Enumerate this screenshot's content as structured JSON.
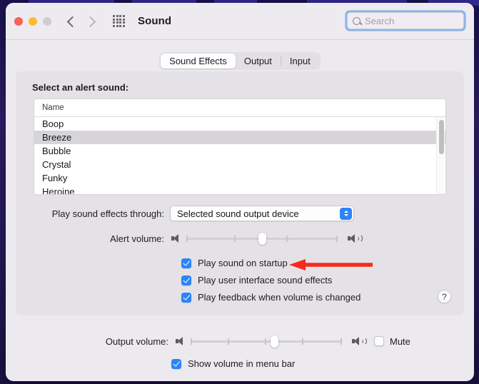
{
  "window": {
    "title": "Sound",
    "traffic_lights": [
      "close",
      "minimize",
      "zoom"
    ],
    "nav": {
      "back": "back-chevron",
      "forward": "forward-chevron"
    },
    "grid_icon": "show-all-icon"
  },
  "search": {
    "placeholder": "Search",
    "value": "",
    "icon": "search-icon"
  },
  "tabs": [
    {
      "label": "Sound Effects",
      "active": true
    },
    {
      "label": "Output",
      "active": false
    },
    {
      "label": "Input",
      "active": false
    }
  ],
  "alert_sound": {
    "section_label": "Select an alert sound:",
    "column_header": "Name",
    "items": [
      {
        "name": "Boop",
        "selected": false
      },
      {
        "name": "Breeze",
        "selected": true
      },
      {
        "name": "Bubble",
        "selected": false
      },
      {
        "name": "Crystal",
        "selected": false
      },
      {
        "name": "Funky",
        "selected": false
      },
      {
        "name": "Heroine",
        "selected": false
      }
    ]
  },
  "play_through": {
    "label": "Play sound effects through:",
    "value": "Selected sound output device"
  },
  "alert_volume": {
    "label": "Alert volume:",
    "value_percent": 50,
    "tick_count": 4,
    "low_icon": "speaker-low-icon",
    "high_icon": "speaker-high-icon"
  },
  "checkboxes": [
    {
      "label": "Play sound on startup",
      "checked": true
    },
    {
      "label": "Play user interface sound effects",
      "checked": true
    },
    {
      "label": "Play feedback when volume is changed",
      "checked": true
    }
  ],
  "help_button": {
    "label": "?"
  },
  "annotation": {
    "type": "arrow",
    "color": "#f32c1e",
    "points_to": "Play sound on startup",
    "direction": "left"
  },
  "output_volume": {
    "label": "Output volume:",
    "value_percent": 55,
    "tick_count": 5,
    "low_icon": "speaker-low-icon",
    "high_icon": "speaker-high-icon"
  },
  "mute": {
    "label": "Mute",
    "checked": false
  },
  "show_volume_menu_bar": {
    "label": "Show volume in menu bar",
    "checked": true
  },
  "colors": {
    "accent": "#2b84fb",
    "annotation_red": "#f32c1e",
    "window_bg": "#eceaee",
    "panel_bg": "#e4e2e7",
    "desktop_bg": "#2a1b63"
  }
}
